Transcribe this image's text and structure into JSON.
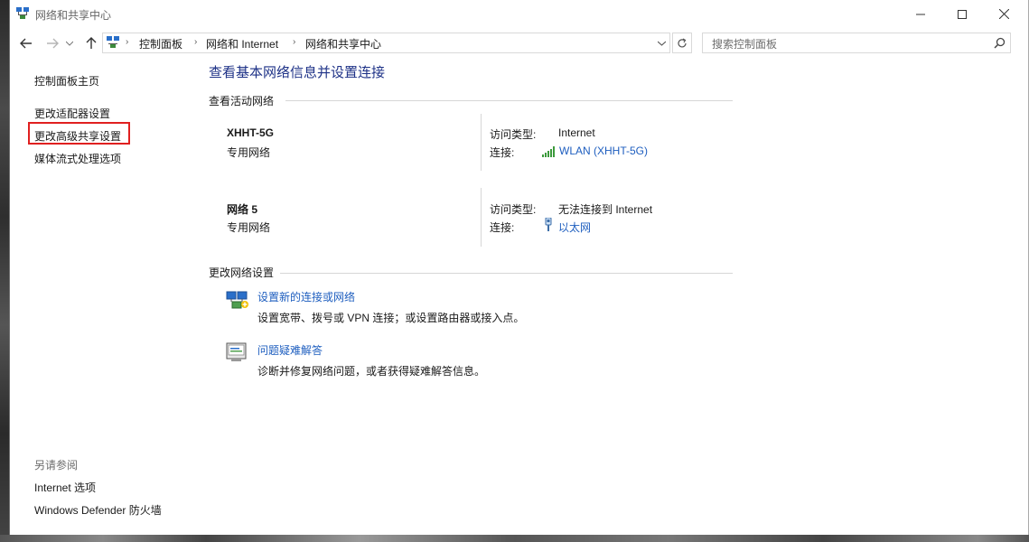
{
  "window": {
    "title": "网络和共享中心"
  },
  "breadcrumb": [
    "控制面板",
    "网络和 Internet",
    "网络和共享中心"
  ],
  "search": {
    "placeholder": "搜索控制面板"
  },
  "sidebar": {
    "home": "控制面板主页",
    "links": [
      "更改适配器设置",
      "更改高级共享设置",
      "媒体流式处理选项"
    ],
    "see_also_title": "另请参阅",
    "see_also": [
      "Internet 选项",
      "Windows Defender 防火墙"
    ]
  },
  "main": {
    "title": "查看基本网络信息并设置连接",
    "active_networks_header": "查看活动网络",
    "networks": [
      {
        "name": "XHHT-5G",
        "category": "专用网络",
        "access_label": "访问类型:",
        "access_value": "Internet",
        "conn_label": "连接:",
        "conn_value": "WLAN (XHHT-5G)",
        "conn_icon": "wifi-signal-icon"
      },
      {
        "name": "网络 5",
        "category": "专用网络",
        "access_label": "访问类型:",
        "access_value": "无法连接到 Internet",
        "conn_label": "连接:",
        "conn_value": "以太网",
        "conn_icon": "ethernet-icon"
      }
    ],
    "change_settings_header": "更改网络设置",
    "tasks": [
      {
        "link": "设置新的连接或网络",
        "desc": "设置宽带、拨号或 VPN 连接；或设置路由器或接入点。",
        "icon": "new-connection-icon"
      },
      {
        "link": "问题疑难解答",
        "desc": "诊断并修复网络问题，或者获得疑难解答信息。",
        "icon": "troubleshoot-icon"
      }
    ]
  },
  "colors": {
    "title_blue": "#1e3287",
    "link_blue": "#1e5ebf",
    "highlight_red": "#e02020"
  }
}
